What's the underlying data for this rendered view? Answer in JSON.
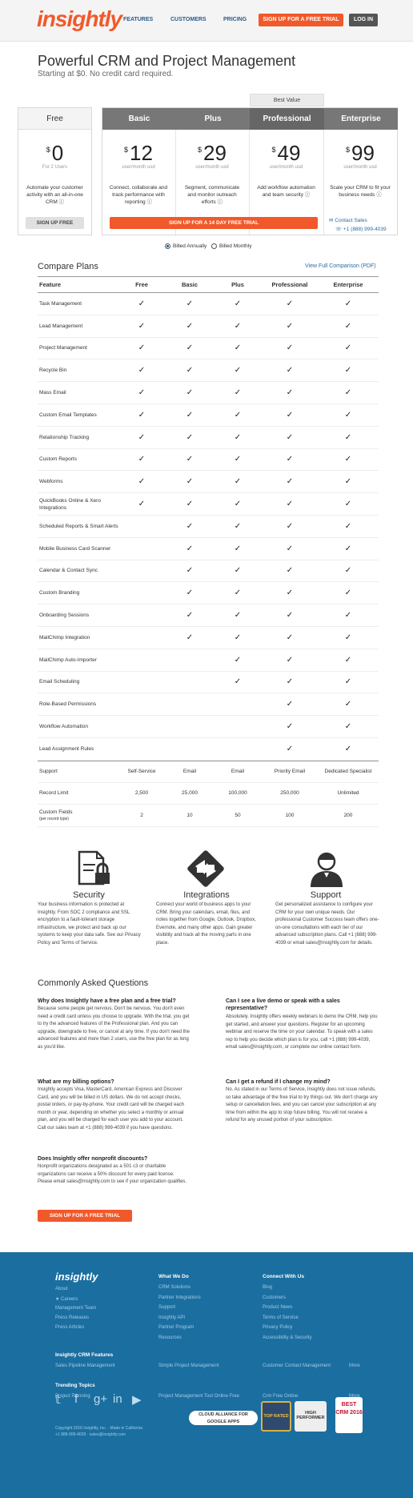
{
  "header": {
    "logo": "insightly",
    "nav": [
      "FEATURES",
      "CUSTOMERS",
      "PRICING"
    ],
    "cta": "SIGN UP FOR A FREE TRIAL",
    "login": "LOG IN"
  },
  "hero": {
    "title": "Powerful CRM and Project Management",
    "subtitle": "Starting at $0. No credit card required."
  },
  "best_value": "Best Value",
  "plans": {
    "free": {
      "name": "Free",
      "price": "0",
      "meta": "For 2 Users",
      "desc": "Automate your customer activity with an all-in-one CRM ⓘ",
      "button": "SIGN UP FREE"
    },
    "paid": [
      {
        "name": "Basic",
        "price": "12",
        "meta": "user/month usd",
        "desc": "Connect, collaborate and track performance with reporting ⓘ"
      },
      {
        "name": "Plus",
        "price": "29",
        "meta": "user/month usd",
        "desc": "Segment, communicate and monitor outreach efforts ⓘ"
      },
      {
        "name": "Professional",
        "price": "49",
        "meta": "user/month usd",
        "desc": "Add workflow automation and team security ⓘ"
      },
      {
        "name": "Enterprise",
        "price": "99",
        "meta": "user/month usd",
        "desc": "Scale your CRM to fit your business needs ⓘ"
      }
    ],
    "currency": "$",
    "trial_button": "SIGN UP FOR A 14 DAY FREE TRIAL",
    "contact": "✉ Contact Sales",
    "phone": "☏ +1 (888) 999-4039"
  },
  "billing": {
    "annual": "Billed Annually",
    "monthly": "Billed Monthly"
  },
  "compare": {
    "title": "Compare Plans",
    "link": "View Full Comparison (PDF)",
    "headers": [
      "Feature",
      "Free",
      "Basic",
      "Plus",
      "Professional",
      "Enterprise"
    ],
    "features": [
      {
        "name": "Task Management",
        "checks": [
          1,
          1,
          1,
          1,
          1
        ]
      },
      {
        "name": "Lead Management",
        "checks": [
          1,
          1,
          1,
          1,
          1
        ]
      },
      {
        "name": "Project Management",
        "checks": [
          1,
          1,
          1,
          1,
          1
        ]
      },
      {
        "name": "Recycle Bin",
        "checks": [
          1,
          1,
          1,
          1,
          1
        ]
      },
      {
        "name": "Mass Email",
        "checks": [
          1,
          1,
          1,
          1,
          1
        ]
      },
      {
        "name": "Custom Email Templates",
        "checks": [
          1,
          1,
          1,
          1,
          1
        ]
      },
      {
        "name": "Relationship Tracking",
        "checks": [
          1,
          1,
          1,
          1,
          1
        ]
      },
      {
        "name": "Custom Reports",
        "checks": [
          1,
          1,
          1,
          1,
          1
        ]
      },
      {
        "name": "Webforms",
        "checks": [
          1,
          1,
          1,
          1,
          1
        ]
      },
      {
        "name": "QuickBooks Online & Xero Integrations",
        "checks": [
          1,
          1,
          1,
          1,
          1
        ]
      },
      {
        "name": "Scheduled Reports & Smart Alerts",
        "checks": [
          0,
          1,
          1,
          1,
          1
        ]
      },
      {
        "name": "Mobile Business Card Scanner",
        "checks": [
          0,
          1,
          1,
          1,
          1
        ]
      },
      {
        "name": "Calendar & Contact Sync",
        "checks": [
          0,
          1,
          1,
          1,
          1
        ]
      },
      {
        "name": "Custom Branding",
        "checks": [
          0,
          1,
          1,
          1,
          1
        ]
      },
      {
        "name": "Onboarding Sessions",
        "checks": [
          0,
          1,
          1,
          1,
          1
        ]
      },
      {
        "name": "MailChimp Integration",
        "checks": [
          0,
          1,
          1,
          1,
          1
        ]
      },
      {
        "name": "MailChimp Auto-Importer",
        "checks": [
          0,
          0,
          1,
          1,
          1
        ]
      },
      {
        "name": "Email Scheduling",
        "checks": [
          0,
          0,
          1,
          1,
          1
        ]
      },
      {
        "name": "Role-Based Permissions",
        "checks": [
          0,
          0,
          0,
          1,
          1
        ]
      },
      {
        "name": "Workflow Automation",
        "checks": [
          0,
          0,
          0,
          1,
          1
        ]
      },
      {
        "name": "Lead Assignment Rules",
        "checks": [
          0,
          0,
          0,
          1,
          1
        ]
      }
    ],
    "value_rows": [
      {
        "name": "Support",
        "vals": [
          "Self-Service",
          "Email",
          "Email",
          "Priority Email",
          "Dedicated Specialist"
        ]
      },
      {
        "name": "Record Limit",
        "vals": [
          "2,500",
          "25,000",
          "100,000",
          "250,000",
          "Unlimited"
        ]
      },
      {
        "name": "Custom Fields",
        "note": "(per record type)",
        "vals": [
          "2",
          "10",
          "50",
          "100",
          "200"
        ]
      }
    ]
  },
  "features_blocks": [
    {
      "title": "Security",
      "icon": "security-icon",
      "desc": "Your business information is protected at Insightly. From SOC 2 compliance and SSL encryption to a fault-tolerant storage infrastructure, we protect and back up our systems to keep your data safe. See our Privacy Policy and Terms of Service."
    },
    {
      "title": "Integrations",
      "icon": "integrations-icon",
      "desc": "Connect your world of business apps to your CRM. Bring your calendars, email, files, and notes together from Google, Outlook, Dropbox, Evernote, and many other apps. Gain greater visibility and track all the moving parts in one place."
    },
    {
      "title": "Support",
      "icon": "support-icon",
      "desc": "Get personalized assistance to configure your CRM for your own unique needs. Our professional Customer Success team offers one-on-one consultations with each tier of our advanced subscription plans. Call +1 (888) 999-4039 or email sales@insightly.com for details."
    }
  ],
  "faq": {
    "title": "Commonly Asked Questions",
    "button": "SIGN UP FOR A FREE TRIAL",
    "items": [
      {
        "q": "Why does Insightly have a free plan and a free trial?",
        "a": "Because some people get nervous. Don't be nervous. You don't even need a credit card unless you choose to upgrade. With the trial, you get to try the advanced features of the Professional plan. And you can upgrade, downgrade to free, or cancel at any time. If you don't need the advanced features and more than 2 users, use the free plan for as long as you'd like."
      },
      {
        "q": "What are my billing options?",
        "a": "Insightly accepts Visa, MasterCard, American Express and Discover Card, and you will be billed in US dollars. We do not accept checks, postal orders, or pay-by-phone. Your credit card will be charged each month or year, depending on whether you select a monthly or annual plan, and you will be charged for each user you add to your account. Call our sales team at +1 (888) 999-4039 if you have questions."
      },
      {
        "q": "Does Insightly offer nonprofit discounts?",
        "a": "Nonprofit organizations designated as a 501 c3 or charitable organizations can receive a 50% discount for every paid license. Please email sales@insightly.com to see if your organization qualifies."
      },
      {
        "q": "Can I see a live demo or speak with a sales representative?",
        "a": "Absolutely. Insightly offers weekly webinars to demo the CRM, help you get started, and answer your questions. Register for an upcoming webinar and reserve the time on your calendar. To speak with a sales rep to help you decide which plan is for you, call +1 (888) 999-4039, email sales@insightly.com, or complete our online contact form."
      },
      {
        "q": "Can I get a refund if I change my mind?",
        "a": "No. As stated in our Terms of Service, Insightly does not issue refunds, so take advantage of the free trial to try things out. We don't charge any setup or cancellation fees, and you can cancel your subscription at any time from within the app to stop future billing. You will not receive a refund for any unused portion of your subscription."
      }
    ]
  },
  "footer": {
    "logo": "insightly",
    "col1": [
      "About",
      "★ Careers",
      "Management Team",
      "Press Releases",
      "Press Articles"
    ],
    "col2_title": "What We Do",
    "col2": [
      "CRM Solutions",
      "Partner Integrations",
      "Support",
      "Insightly API",
      "Partner Program",
      "Resources"
    ],
    "col3_title": "Connect With Us",
    "col3": [
      "Blog",
      "Customers",
      "Product News",
      "Terms of Service",
      "Privacy Policy",
      "Accessibility & Security"
    ],
    "crm_title": "Insightly CRM Features",
    "crm": [
      "Sales Pipeline Management",
      "Simple Project Management",
      "Customer Contact Management",
      "More"
    ],
    "trend_title": "Trending Topics",
    "trend": [
      "Project Planning",
      "Project Management Tool Online Free",
      "Crm Free Online",
      "More"
    ],
    "social": [
      "𝕥",
      "f",
      "g+",
      "in",
      "▶"
    ],
    "copyright": "Copyright 2016 Insightly, Inc. · Made in California",
    "contact": "+1 888-999-4039 · sales@insightly.com",
    "badges": [
      "CLOUD ALLIANCE FOR GOOGLE APPS",
      "TOP RATED",
      "HIGH PERFORMER",
      "BEST CRM 2016"
    ]
  },
  "colors": {
    "accent": "#f1592a",
    "link": "#2a6ca3",
    "footer": "#1b6ea0"
  }
}
